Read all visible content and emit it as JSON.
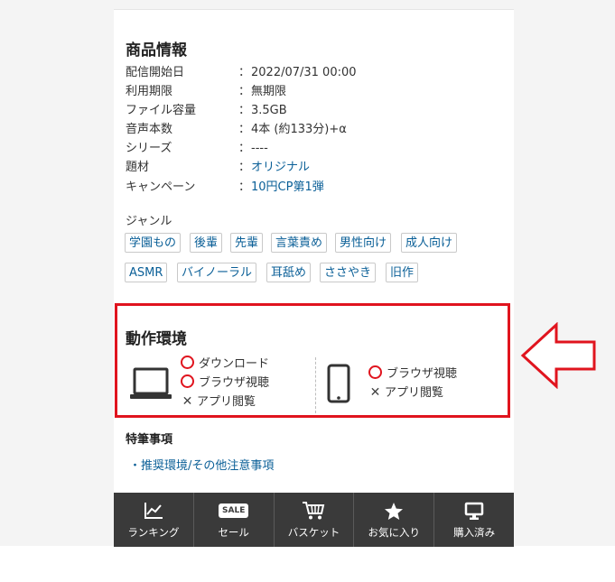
{
  "product_info": {
    "title": "商品情報",
    "rows": [
      {
        "label": "配信開始日",
        "value": "2022/07/31 00:00",
        "link": false
      },
      {
        "label": "利用期限",
        "value": "無期限",
        "link": false
      },
      {
        "label": "ファイル容量",
        "value": "3.5GB",
        "link": false
      },
      {
        "label": "音声本数",
        "value": "4本 (約133分)+α",
        "link": false
      },
      {
        "label": "シリーズ",
        "value": "----",
        "link": false
      },
      {
        "label": "題材",
        "value": "オリジナル",
        "link": true
      },
      {
        "label": "キャンペーン",
        "value": "10円CP第1弾",
        "link": true
      }
    ],
    "colon": "："
  },
  "genre": {
    "heading": "ジャンル",
    "tags": [
      "学園もの",
      "後輩",
      "先輩",
      "言葉責め",
      "男性向け",
      "成人向け",
      "ASMR",
      "バイノーラル",
      "耳舐め",
      "ささやき",
      "旧作"
    ]
  },
  "environment": {
    "title": "動作環境",
    "pc": [
      {
        "mark": "circle",
        "label": "ダウンロード"
      },
      {
        "mark": "circle",
        "label": "ブラウザ視聴"
      },
      {
        "mark": "cross",
        "label": "アプリ閲覧"
      }
    ],
    "smartphone": [
      {
        "mark": "circle",
        "label": "ブラウザ視聴"
      },
      {
        "mark": "cross",
        "label": "アプリ閲覧"
      }
    ],
    "highlight_color": "#e0141e"
  },
  "notes": {
    "title": "特筆事項",
    "link_label": "・推奨環境/その他注意事項"
  },
  "tabbar": {
    "tabs": [
      {
        "icon": "chart-line-icon",
        "label": "ランキング"
      },
      {
        "icon": "sale-tag-icon",
        "label": "セール",
        "badge": "SALE"
      },
      {
        "icon": "basket-icon",
        "label": "バスケット"
      },
      {
        "icon": "star-icon",
        "label": "お気に入り"
      },
      {
        "icon": "monitor-icon",
        "label": "購入済み"
      }
    ]
  },
  "colors": {
    "link": "#0a5f97",
    "tabbar_bg": "#3a3a3a",
    "arrow": "#e0141e"
  }
}
